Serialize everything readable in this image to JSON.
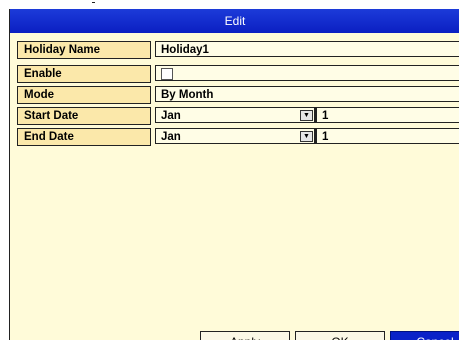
{
  "dialog": {
    "title": "Edit",
    "fields": {
      "holiday_name": {
        "label": "Holiday Name",
        "value": "Holiday1"
      },
      "enable": {
        "label": "Enable",
        "checked": false
      },
      "mode": {
        "label": "Mode",
        "value": "By Month"
      },
      "start_date": {
        "label": "Start Date",
        "month": "Jan",
        "day": "1"
      },
      "end_date": {
        "label": "End Date",
        "month": "Jan",
        "day": "1"
      }
    },
    "buttons": {
      "apply": "Apply",
      "ok": "OK",
      "cancel": "Cancel"
    }
  },
  "icons": {
    "dropdown": "chevron-down-icon",
    "checkbox": "checkbox-icon"
  },
  "colors": {
    "title_bar": "#0b1fc2",
    "label_bg": "#fbe8aa",
    "dialog_bg": "#fffbd9",
    "primary_button": "#0a22c8"
  }
}
